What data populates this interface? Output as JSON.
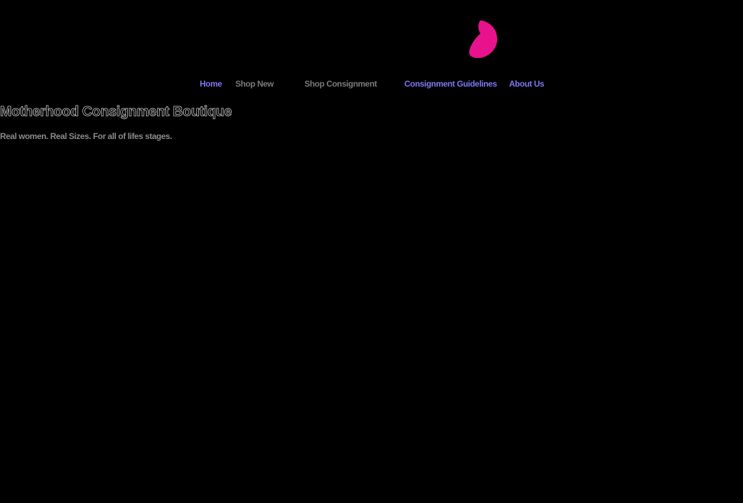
{
  "brand": {
    "logo_icon": "butterfly-wing-icon",
    "logo_color": "#e8128c"
  },
  "nav": {
    "items": [
      {
        "label": "Home",
        "state": "active"
      },
      {
        "label": "Shop New",
        "state": "inactive"
      },
      {
        "label": "Shop Consignment",
        "state": "inactive"
      },
      {
        "label": "Consignment Guidelines",
        "state": "active"
      },
      {
        "label": "About Us",
        "state": "active"
      }
    ],
    "active_color": "#7b78f0",
    "inactive_color": "#7a7a7a"
  },
  "header": {
    "title": "Motherhood Consignment Boutique",
    "tagline": "Real women. Real Sizes. For all of lifes stages."
  }
}
